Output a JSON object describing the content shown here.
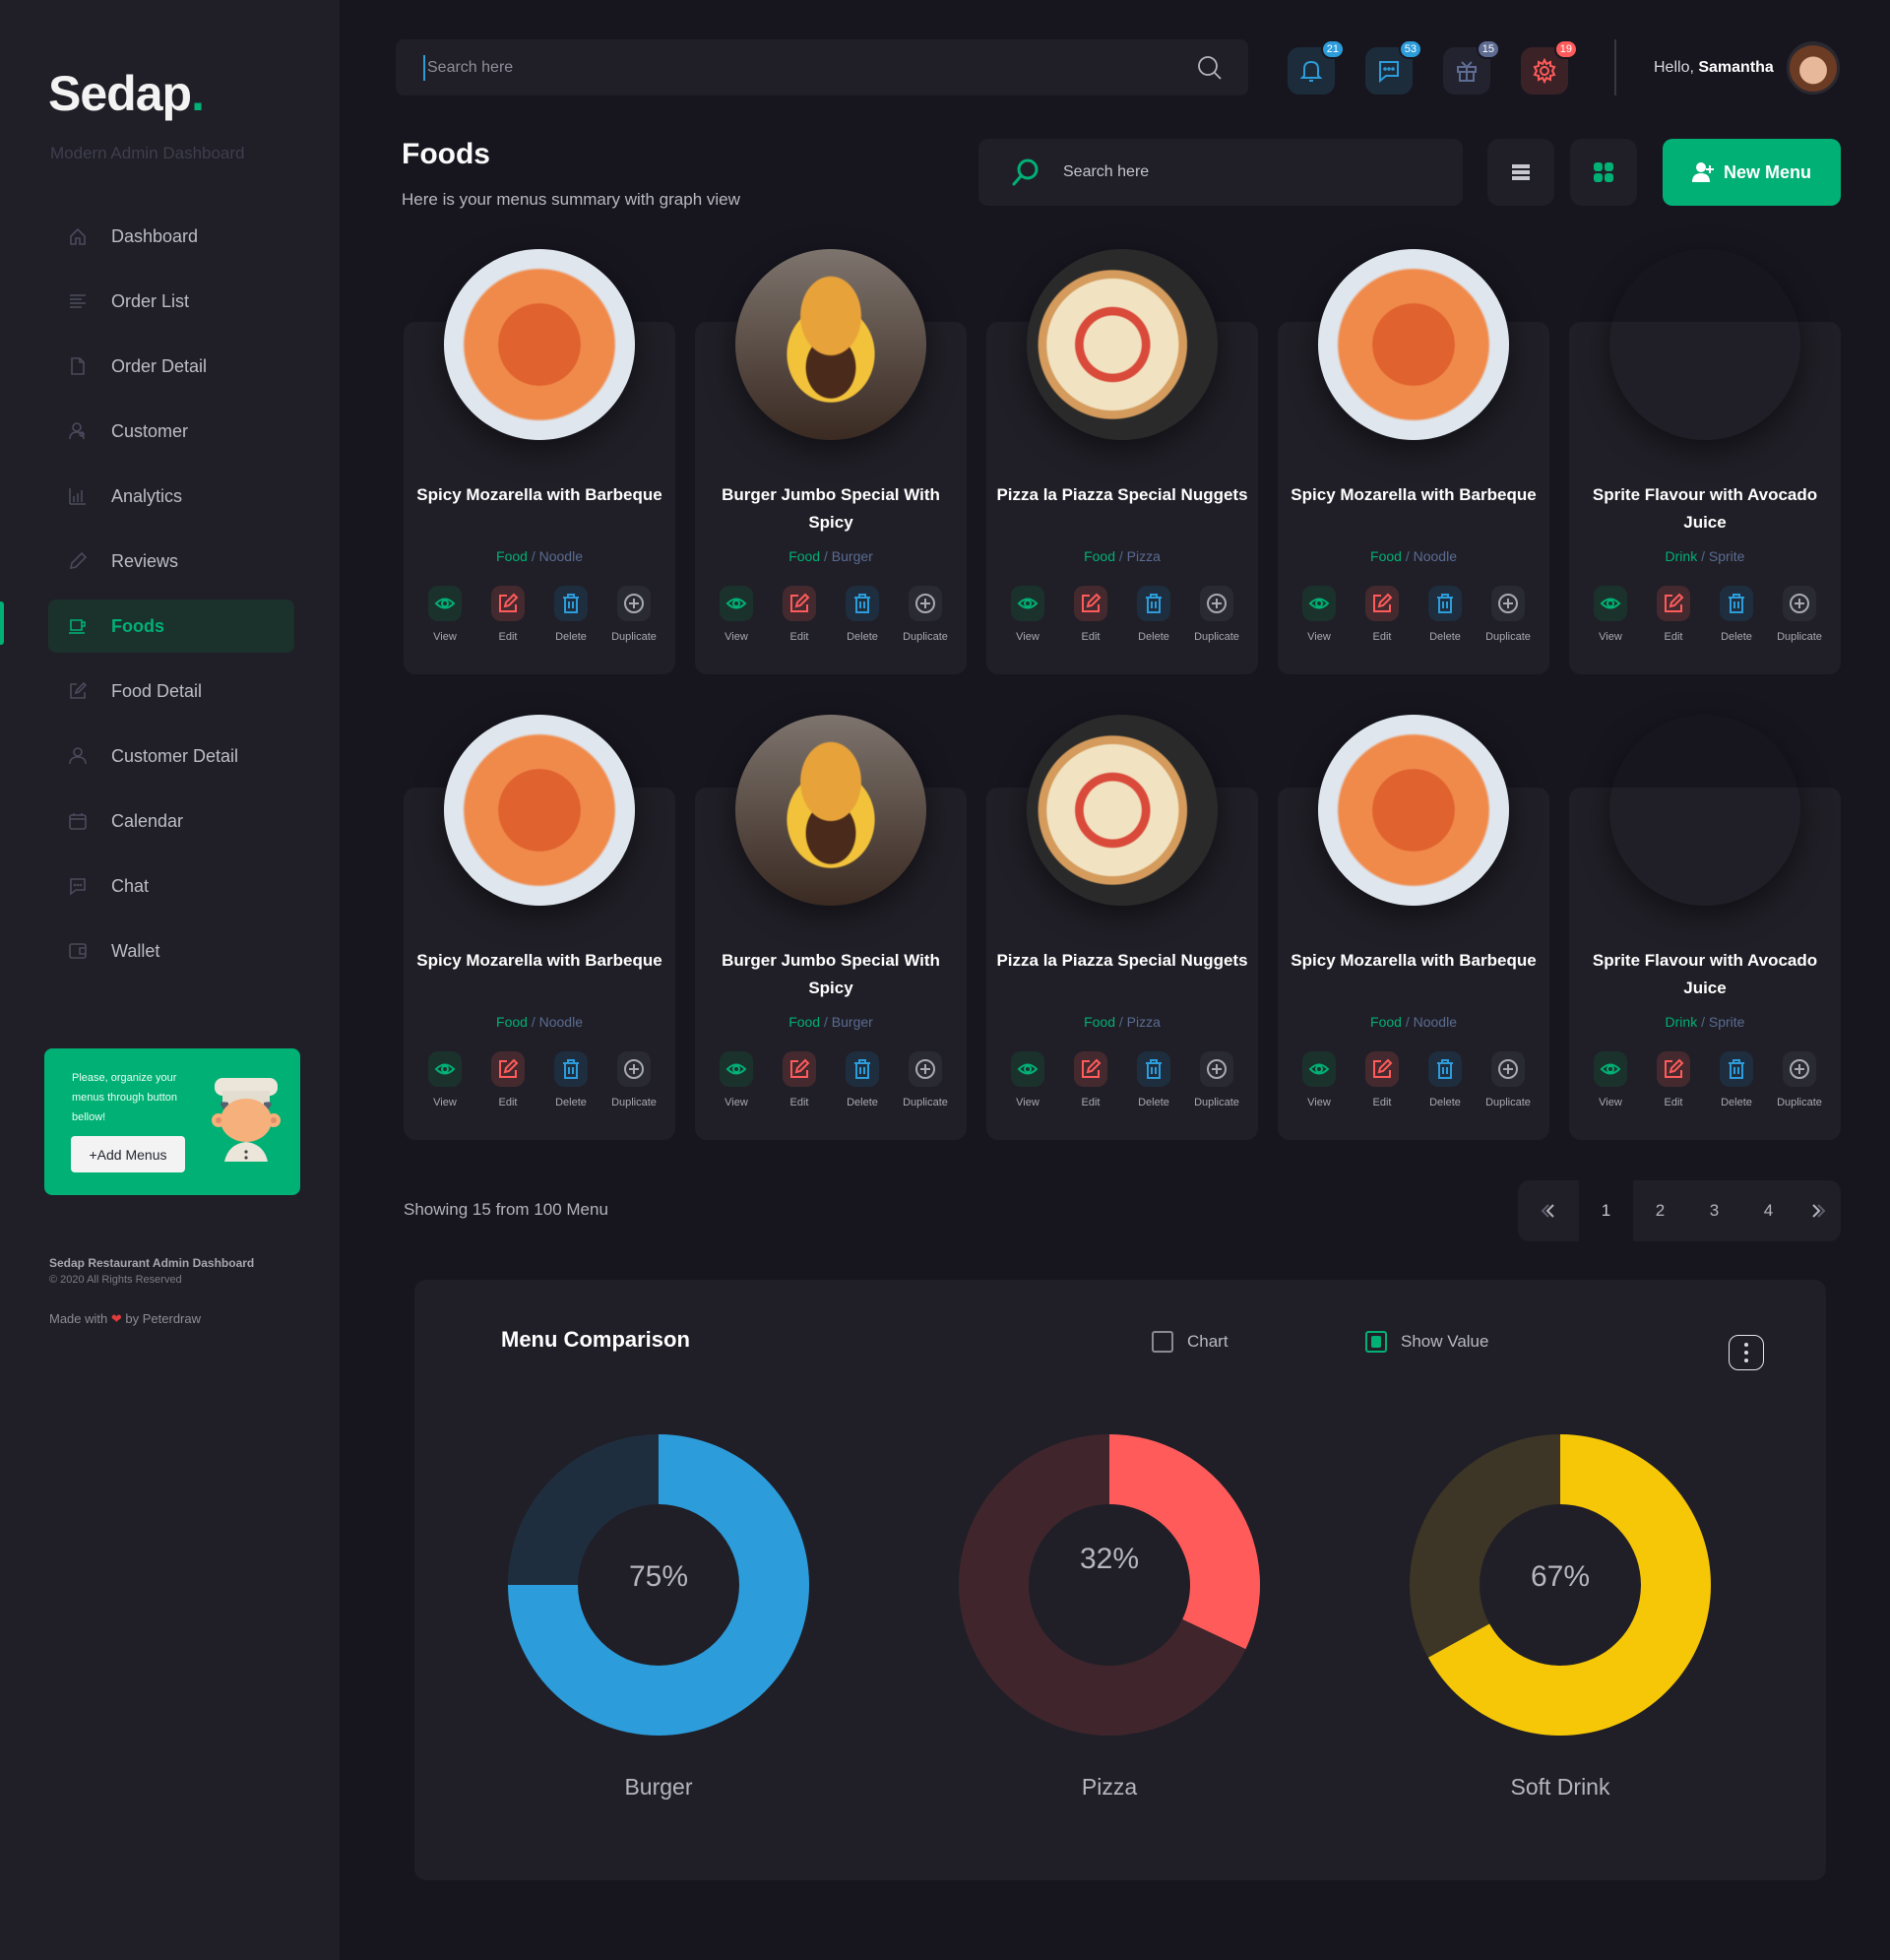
{
  "sidebar": {
    "logo": "Sedap",
    "logo_dot": ".",
    "tagline": "Modern Admin Dashboard",
    "items": [
      {
        "label": "Dashboard",
        "icon": "home-icon",
        "active": false
      },
      {
        "label": "Order List",
        "icon": "list-icon",
        "active": false
      },
      {
        "label": "Order Detail",
        "icon": "document-icon",
        "active": false
      },
      {
        "label": "Customer",
        "icon": "customer-icon",
        "active": false
      },
      {
        "label": "Analytics",
        "icon": "bar-chart-icon",
        "active": false
      },
      {
        "label": "Reviews",
        "icon": "pencil-icon",
        "active": false
      },
      {
        "label": "Foods",
        "icon": "cup-icon",
        "active": true
      },
      {
        "label": "Food Detail",
        "icon": "edit-square-icon",
        "active": false
      },
      {
        "label": "Customer Detail",
        "icon": "user-icon",
        "active": false
      },
      {
        "label": "Calendar",
        "icon": "calendar-icon",
        "active": false
      },
      {
        "label": "Chat",
        "icon": "chat-icon",
        "active": false
      },
      {
        "label": "Wallet",
        "icon": "wallet-icon",
        "active": false
      }
    ],
    "promo": {
      "text": "Please, organize your menus through button bellow!",
      "button": "+Add Menus"
    },
    "footer": {
      "title": "Sedap Restaurant Admin Dashboard",
      "copyright": "© 2020 All Rights Reserved",
      "made_with_prefix": "Made with",
      "made_with_suffix": "by Peterdraw"
    }
  },
  "topbar": {
    "search_placeholder": "Search here",
    "notifications": [
      {
        "icon": "bell-icon",
        "count": "21",
        "color": "#2d9cdb",
        "bg": "#1d2c3b"
      },
      {
        "icon": "chat-icon",
        "count": "53",
        "color": "#2d9cdb",
        "bg": "#1d2c3b"
      },
      {
        "icon": "gift-icon",
        "count": "15",
        "color": "#5e6c93",
        "bg": "#22232e"
      },
      {
        "icon": "gear-icon",
        "count": "19",
        "color": "#ff5b5b",
        "bg": "#3a2227"
      }
    ],
    "greeting": "Hello,",
    "user_name": "Samantha"
  },
  "header": {
    "title": "Foods",
    "subtitle": "Here is your menus summary with graph view",
    "search_placeholder": "Search here",
    "new_menu_label": "New Menu"
  },
  "actions": [
    {
      "key": "view",
      "label": "View",
      "icon": "eye-icon",
      "color": "#00b074",
      "bg": "#1b322c"
    },
    {
      "key": "edit",
      "label": "Edit",
      "icon": "edit-icon",
      "color": "#ff5b5b",
      "bg": "#442a2f"
    },
    {
      "key": "delete",
      "label": "Delete",
      "icon": "trash-icon",
      "color": "#2d9cdb",
      "bg": "#1e2e3e"
    },
    {
      "key": "duplicate",
      "label": "Duplicate",
      "icon": "plus-circle-icon",
      "color": "#a9a9b2",
      "bg": "#2a2a33"
    }
  ],
  "foods": [
    {
      "title": "Spicy Mozarella with Barbeque",
      "category": "Food",
      "sub": "Noodle",
      "image": "noodle"
    },
    {
      "title": "Burger Jumbo Special With Spicy",
      "category": "Food",
      "sub": "Burger",
      "image": "burger"
    },
    {
      "title": "Pizza la Piazza Special Nuggets",
      "category": "Food",
      "sub": "Pizza",
      "image": "pizza"
    },
    {
      "title": "Spicy Mozarella with Barbeque",
      "category": "Food",
      "sub": "Noodle",
      "image": "noodle"
    },
    {
      "title": "Sprite Flavour with Avocado Juice",
      "category": "Drink",
      "sub": "Sprite",
      "image": "juice"
    },
    {
      "title": "Spicy Mozarella with Barbeque",
      "category": "Food",
      "sub": "Noodle",
      "image": "noodle"
    },
    {
      "title": "Burger Jumbo Special With Spicy",
      "category": "Food",
      "sub": "Burger",
      "image": "burger"
    },
    {
      "title": "Pizza la Piazza Special Nuggets",
      "category": "Food",
      "sub": "Pizza",
      "image": "pizza"
    },
    {
      "title": "Spicy Mozarella with Barbeque",
      "category": "Food",
      "sub": "Noodle",
      "image": "noodle"
    },
    {
      "title": "Sprite Flavour with Avocado Juice",
      "category": "Drink",
      "sub": "Sprite",
      "image": "juice"
    }
  ],
  "pagination": {
    "showing": "Showing 15 from 100 Menu",
    "pages": [
      "1",
      "2",
      "3",
      "4"
    ],
    "current": "1",
    "prev_icon": "chevron-double-left-icon",
    "next_icon": "chevron-double-right-icon"
  },
  "comparison": {
    "title": "Menu Comparison",
    "options": [
      {
        "label": "Chart",
        "checked": false
      },
      {
        "label": "Show Value",
        "checked": true
      }
    ],
    "menu_icon": "more-vertical-icon"
  },
  "chart_data": {
    "type": "pie",
    "title": "Menu Comparison",
    "variant": "donut",
    "series": [
      {
        "name": "Burger",
        "value": 75,
        "label": "75%",
        "color": "#2d9cdb",
        "track": "#1f2e3e"
      },
      {
        "name": "Pizza",
        "value": 32,
        "label": "32%",
        "color": "#ff5b5b",
        "track": "#40262c"
      },
      {
        "name": "Soft Drink",
        "value": 67,
        "label": "67%",
        "color": "#f6c707",
        "track": "#3d3626"
      }
    ],
    "show_values": true
  }
}
